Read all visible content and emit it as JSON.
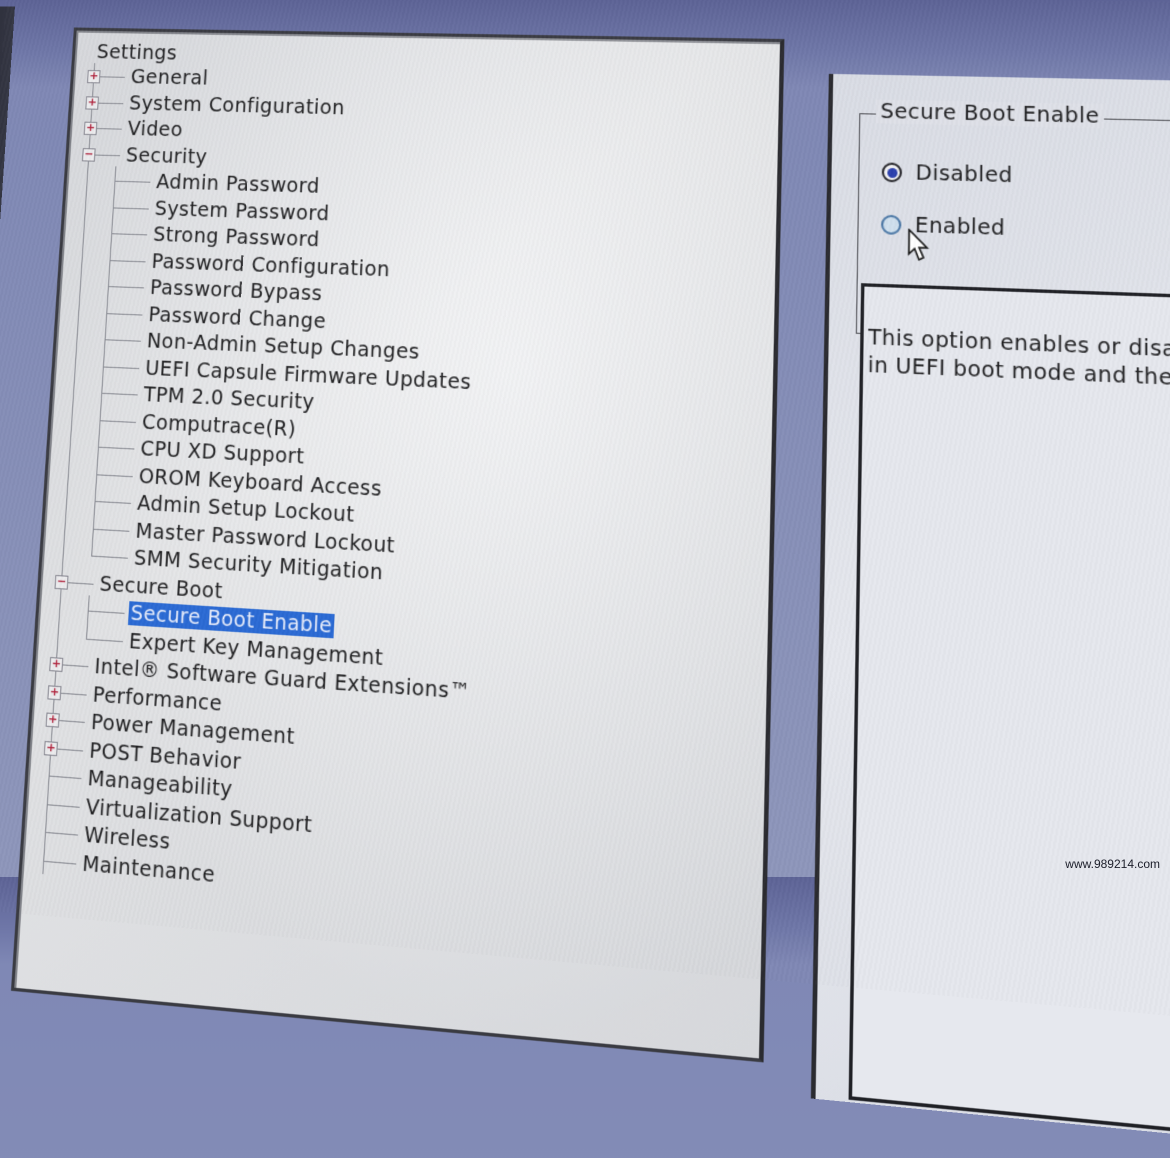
{
  "tree": {
    "root": "Settings",
    "items": [
      {
        "label": "General",
        "level": 1,
        "expander": "+"
      },
      {
        "label": "System Configuration",
        "level": 1,
        "expander": "+"
      },
      {
        "label": "Video",
        "level": 1,
        "expander": "+"
      },
      {
        "label": "Security",
        "level": 1,
        "expander": "-"
      },
      {
        "label": "Admin Password",
        "level": 2
      },
      {
        "label": "System Password",
        "level": 2
      },
      {
        "label": "Strong Password",
        "level": 2
      },
      {
        "label": "Password Configuration",
        "level": 2
      },
      {
        "label": "Password Bypass",
        "level": 2
      },
      {
        "label": "Password Change",
        "level": 2
      },
      {
        "label": "Non-Admin Setup Changes",
        "level": 2
      },
      {
        "label": "UEFI Capsule Firmware Updates",
        "level": 2
      },
      {
        "label": "TPM 2.0 Security",
        "level": 2
      },
      {
        "label": "Computrace(R)",
        "level": 2
      },
      {
        "label": "CPU XD Support",
        "level": 2
      },
      {
        "label": "OROM Keyboard Access",
        "level": 2
      },
      {
        "label": "Admin Setup Lockout",
        "level": 2
      },
      {
        "label": "Master Password Lockout",
        "level": 2
      },
      {
        "label": "SMM Security Mitigation",
        "level": 2
      },
      {
        "label": "Secure Boot",
        "level": 1,
        "expander": "-"
      },
      {
        "label": "Secure Boot Enable",
        "level": 2,
        "selected": true
      },
      {
        "label": "Expert Key Management",
        "level": 2
      },
      {
        "label": "Intel® Software Guard Extensions™",
        "level": 1,
        "expander": "+"
      },
      {
        "label": "Performance",
        "level": 1,
        "expander": "+"
      },
      {
        "label": "Power Management",
        "level": 1,
        "expander": "+"
      },
      {
        "label": "POST Behavior",
        "level": 1,
        "expander": "+"
      },
      {
        "label": "Manageability",
        "level": 1
      },
      {
        "label": "Virtualization Support",
        "level": 1
      },
      {
        "label": "Wireless",
        "level": 1
      },
      {
        "label": "Maintenance",
        "level": 1
      }
    ]
  },
  "detail": {
    "group_title": "Secure Boot Enable",
    "options": [
      {
        "label": "Disabled",
        "checked": true
      },
      {
        "label": "Enabled",
        "checked": false
      }
    ],
    "description": "This option enables or disab… in UEFI boot mode and the…",
    "description_lines": [
      "This option enables or disab",
      "in UEFI boot mode and the"
    ]
  },
  "watermark": "www.989214.com",
  "colors": {
    "selection": "#2a6ad4",
    "radio_dot": "#2b3fae",
    "expander_plus": "#b0203a"
  }
}
